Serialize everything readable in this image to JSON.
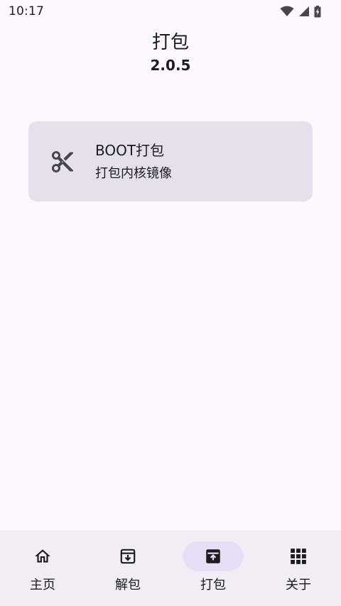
{
  "status_bar": {
    "time": "10:17",
    "icons": [
      "wifi-icon",
      "signal-icon",
      "battery-charging-icon"
    ]
  },
  "header": {
    "title": "打包",
    "version": "2.0.5"
  },
  "cards": [
    {
      "icon": "scissors-icon",
      "title": "BOOT打包",
      "subtitle": "打包内核镜像"
    }
  ],
  "bottom_nav": {
    "active": "打包",
    "items": [
      {
        "icon": "home-icon",
        "label": "主页"
      },
      {
        "icon": "archive-download-icon",
        "label": "解包"
      },
      {
        "icon": "archive-upload-icon",
        "label": "打包"
      },
      {
        "icon": "apps-grid-icon",
        "label": "关于"
      }
    ]
  },
  "colors": {
    "background": "#fdf8fd",
    "card": "#e5e0eb",
    "nav_background": "#f2ecf4",
    "nav_active_indicator": "#e8def8",
    "text": "#1c1b1f"
  }
}
